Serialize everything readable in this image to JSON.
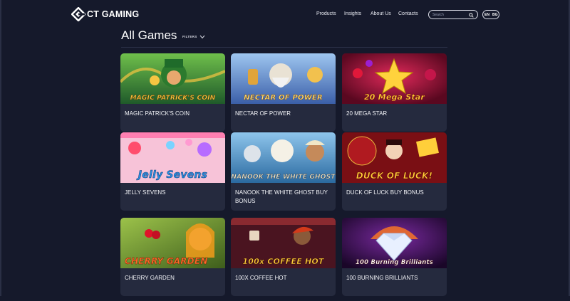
{
  "brand": {
    "name": "CT GAMING"
  },
  "nav": {
    "items": [
      {
        "label": "Products"
      },
      {
        "label": "Insights"
      },
      {
        "label": "About Us"
      },
      {
        "label": "Contacts"
      }
    ]
  },
  "search": {
    "placeholder": "Search",
    "icon": "search-icon"
  },
  "languages": [
    {
      "code": "EN",
      "selected": true
    },
    {
      "code": "BG",
      "selected": false
    }
  ],
  "page": {
    "title": "All Games",
    "filters_label": "FILTERS"
  },
  "games": [
    {
      "title": "MAGIC PATRICK'S COIN",
      "art_text": "MAGIC PATRICK'S COIN",
      "colors": [
        "#2c7a2e",
        "#f5c542"
      ]
    },
    {
      "title": "NECTAR OF POWER",
      "art_text": "NECTAR OF POWER",
      "colors": [
        "#3b5fa8",
        "#f2c14e"
      ]
    },
    {
      "title": "20 MEGA STAR",
      "art_text": "20 Mega Star",
      "colors": [
        "#a3123a",
        "#ffd23d"
      ]
    },
    {
      "title": "JELLY SEVENS",
      "art_text": "Jelly Sevens",
      "colors": [
        "#f4a3c4",
        "#2a8fe0"
      ]
    },
    {
      "title": "NANOOK THE WHITE GHOST BUY BONUS",
      "art_text": "NANOOK THE WHITE GHOST",
      "colors": [
        "#2b6aa0",
        "#f1e7c7"
      ]
    },
    {
      "title": "DUCK OF LUCK BUY BONUS",
      "art_text": "DUCK OF LUCK!",
      "colors": [
        "#7a0f14",
        "#ffcf3a"
      ]
    },
    {
      "title": "CHERRY GARDEN",
      "art_text": "CHERRY GARDEN",
      "colors": [
        "#5b7d2a",
        "#ff6a2a"
      ]
    },
    {
      "title": "100X COFFEE HOT",
      "art_text": "100x COFFEE HOT",
      "colors": [
        "#6a1f2a",
        "#ffd23d"
      ]
    },
    {
      "title": "100 BURNING BRILLIANTS",
      "art_text": "100 Burning Brilliants",
      "colors": [
        "#3a0b52",
        "#ff7a1f"
      ]
    }
  ]
}
